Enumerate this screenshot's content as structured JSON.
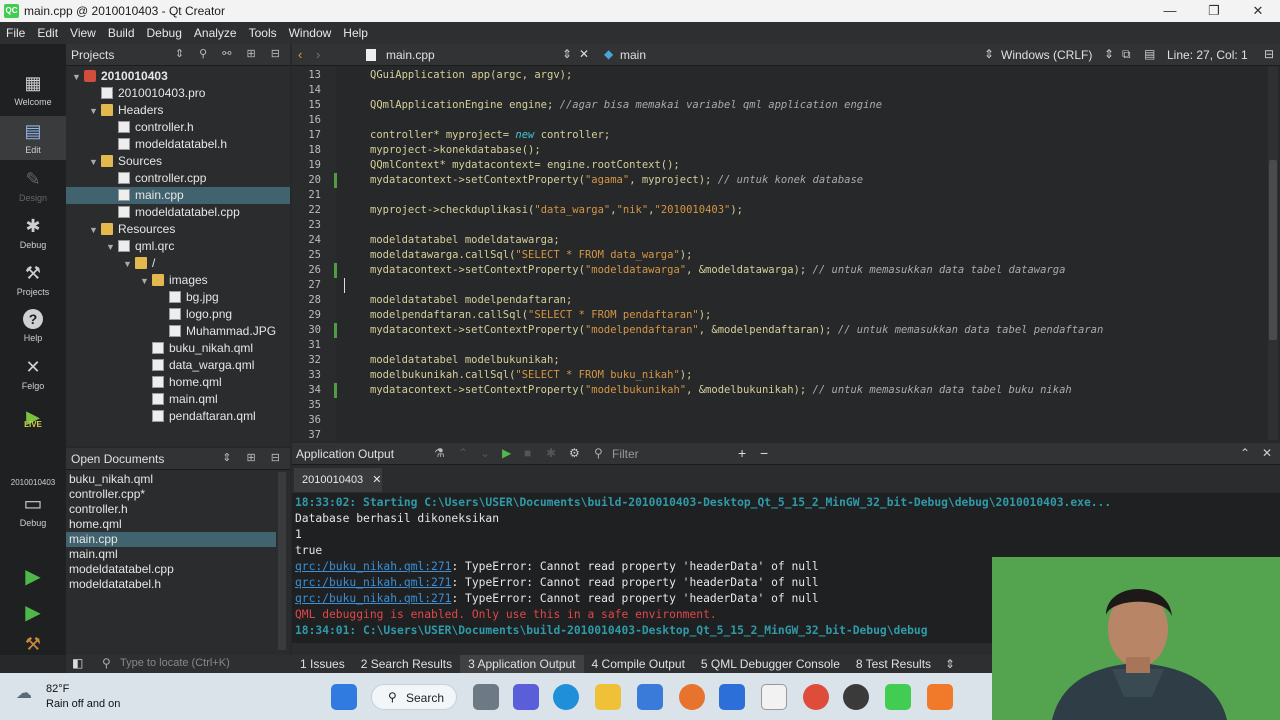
{
  "window": {
    "title": "main.cpp @ 2010010403 - Qt Creator",
    "app_icon_text": "QC",
    "minimize_glyph": "—",
    "maximize_glyph": "❐",
    "close_glyph": "✕"
  },
  "menu": [
    "File",
    "Edit",
    "View",
    "Build",
    "Debug",
    "Analyze",
    "Tools",
    "Window",
    "Help"
  ],
  "modes": [
    {
      "label": "Welcome",
      "icon": "grid-icon",
      "glyph": "▦"
    },
    {
      "label": "Edit",
      "icon": "edit-icon",
      "glyph": "▤"
    },
    {
      "label": "Design",
      "icon": "design-icon",
      "glyph": "✎"
    },
    {
      "label": "Debug",
      "icon": "bug-icon",
      "glyph": "✱"
    },
    {
      "label": "Projects",
      "icon": "wrench-icon",
      "glyph": "⚒"
    },
    {
      "label": "Help",
      "icon": "help-icon",
      "glyph": "?"
    },
    {
      "label": "Felgo",
      "icon": "felgo-icon",
      "glyph": "✕"
    },
    {
      "label": "LIVE",
      "icon": "live-icon",
      "glyph": "▶"
    }
  ],
  "kit": {
    "project": "2010010403",
    "label": "Debug"
  },
  "projects_pane": {
    "title": "Projects",
    "tree": [
      {
        "label": "2010010403",
        "depth": 0,
        "type": "proj",
        "expanded": true,
        "bold": true
      },
      {
        "label": "2010010403.pro",
        "depth": 1,
        "type": "file"
      },
      {
        "label": "Headers",
        "depth": 1,
        "type": "folder",
        "expanded": true
      },
      {
        "label": "controller.h",
        "depth": 2,
        "type": "file"
      },
      {
        "label": "modeldatatabel.h",
        "depth": 2,
        "type": "file"
      },
      {
        "label": "Sources",
        "depth": 1,
        "type": "folder",
        "expanded": true
      },
      {
        "label": "controller.cpp",
        "depth": 2,
        "type": "file"
      },
      {
        "label": "main.cpp",
        "depth": 2,
        "type": "file",
        "selected": true
      },
      {
        "label": "modeldatatabel.cpp",
        "depth": 2,
        "type": "file"
      },
      {
        "label": "Resources",
        "depth": 1,
        "type": "folder",
        "expanded": true
      },
      {
        "label": "qml.qrc",
        "depth": 2,
        "type": "file",
        "expanded": true
      },
      {
        "label": "/",
        "depth": 3,
        "type": "folder",
        "expanded": true
      },
      {
        "label": "images",
        "depth": 4,
        "type": "folder",
        "expanded": true
      },
      {
        "label": "bg.jpg",
        "depth": 5,
        "type": "file"
      },
      {
        "label": "logo.png",
        "depth": 5,
        "type": "file"
      },
      {
        "label": "Muhammad.JPG",
        "depth": 5,
        "type": "file"
      },
      {
        "label": "buku_nikah.qml",
        "depth": 4,
        "type": "file"
      },
      {
        "label": "data_warga.qml",
        "depth": 4,
        "type": "file"
      },
      {
        "label": "home.qml",
        "depth": 4,
        "type": "file"
      },
      {
        "label": "main.qml",
        "depth": 4,
        "type": "file"
      },
      {
        "label": "pendaftaran.qml",
        "depth": 4,
        "type": "file"
      }
    ]
  },
  "open_documents": {
    "title": "Open Documents",
    "items": [
      "buku_nikah.qml",
      "controller.cpp*",
      "controller.h",
      "home.qml",
      "main.cpp",
      "main.qml",
      "modeldatatabel.cpp",
      "modeldatatabel.h"
    ],
    "selected_index": 4
  },
  "editor": {
    "file": "main.cpp",
    "symbol": "main",
    "encoding": "Windows (CRLF)",
    "position": "Line: 27, Col: 1",
    "lines": [
      {
        "n": "13",
        "code": [
          [
            "QGuiApplication app(argc, argv);",
            ""
          ]
        ]
      },
      {
        "n": "14",
        "code": []
      },
      {
        "n": "15",
        "code": [
          [
            "QQmlApplicationEngine engine; ",
            ""
          ],
          [
            "//agar bisa memakai variabel qml application engine",
            "c"
          ]
        ]
      },
      {
        "n": "16",
        "code": []
      },
      {
        "n": "17",
        "code": [
          [
            "controller* myproject= ",
            ""
          ],
          [
            "new",
            "k"
          ],
          [
            " controller;",
            ""
          ]
        ]
      },
      {
        "n": "18",
        "code": [
          [
            "myproject->konekdatabase();",
            ""
          ]
        ]
      },
      {
        "n": "19",
        "code": [
          [
            "QQmlContext* mydatacontext= engine.rootContext();",
            ""
          ]
        ]
      },
      {
        "n": "20",
        "mark": true,
        "code": [
          [
            "mydatacontext->setContextProperty(",
            ""
          ],
          [
            "\"agama\"",
            "s"
          ],
          [
            ", myproject); ",
            ""
          ],
          [
            "// untuk konek database",
            "c"
          ]
        ]
      },
      {
        "n": "21",
        "code": []
      },
      {
        "n": "22",
        "code": [
          [
            "myproject->checkduplikasi(",
            ""
          ],
          [
            "\"data_warga\"",
            "s"
          ],
          [
            ",",
            ""
          ],
          [
            "\"nik\"",
            "s"
          ],
          [
            ",",
            ""
          ],
          [
            "\"2010010403\"",
            "s"
          ],
          [
            ");",
            ""
          ]
        ]
      },
      {
        "n": "23",
        "code": []
      },
      {
        "n": "24",
        "code": [
          [
            "modeldatatabel modeldatawarga;",
            ""
          ]
        ]
      },
      {
        "n": "25",
        "code": [
          [
            "modeldatawarga.callSql(",
            ""
          ],
          [
            "\"SELECT * FROM data_warga\"",
            "s"
          ],
          [
            ");",
            ""
          ]
        ]
      },
      {
        "n": "26",
        "mark": true,
        "code": [
          [
            "mydatacontext->setContextProperty(",
            ""
          ],
          [
            "\"modeldatawarga\"",
            "s"
          ],
          [
            ", &modeldatawarga); ",
            ""
          ],
          [
            "// untuk memasukkan data tabel datawarga",
            "c"
          ]
        ]
      },
      {
        "n": "27",
        "code": []
      },
      {
        "n": "28",
        "code": [
          [
            "modeldatatabel modelpendaftaran;",
            ""
          ]
        ]
      },
      {
        "n": "29",
        "code": [
          [
            "modelpendaftaran.callSql(",
            ""
          ],
          [
            "\"SELECT * FROM pendaftaran\"",
            "s"
          ],
          [
            ");",
            ""
          ]
        ]
      },
      {
        "n": "30",
        "mark": true,
        "code": [
          [
            "mydatacontext->setContextProperty(",
            ""
          ],
          [
            "\"modelpendaftaran\"",
            "s"
          ],
          [
            ", &modelpendaftaran); ",
            ""
          ],
          [
            "// untuk memasukkan data tabel pendaftaran",
            "c"
          ]
        ]
      },
      {
        "n": "31",
        "code": []
      },
      {
        "n": "32",
        "code": [
          [
            "modeldatatabel modelbukunikah;",
            ""
          ]
        ]
      },
      {
        "n": "33",
        "code": [
          [
            "modelbukunikah.callSql(",
            ""
          ],
          [
            "\"SELECT * FROM buku_nikah\"",
            "s"
          ],
          [
            ");",
            ""
          ]
        ]
      },
      {
        "n": "34",
        "mark": true,
        "code": [
          [
            "mydatacontext->setContextProperty(",
            ""
          ],
          [
            "\"modelbukunikah\"",
            "s"
          ],
          [
            ", &modelbukunikah); ",
            ""
          ],
          [
            "// untuk memasukkan data tabel buku nikah",
            "c"
          ]
        ]
      },
      {
        "n": "35",
        "code": []
      },
      {
        "n": "36",
        "code": []
      },
      {
        "n": "37",
        "code": []
      }
    ]
  },
  "output_pane": {
    "title": "Application Output",
    "filter_placeholder": "Filter",
    "tab": "2010010403",
    "lines": [
      {
        "text": "18:33:02: Starting C:\\Users\\USER\\Documents\\build-2010010403-Desktop_Qt_5_15_2_MinGW_32_bit-Debug\\debug\\2010010403.exe...",
        "color": "#2f9aa8",
        "bold": true
      },
      {
        "text": "Database berhasil dikoneksikan",
        "color": "#e6e6e6"
      },
      {
        "text": "1",
        "color": "#e6e6e6"
      },
      {
        "text": "true",
        "color": "#e6e6e6"
      },
      {
        "link": "qrc:/buku_nikah.qml:271",
        "text": ": TypeError: Cannot read property 'headerData' of null",
        "color": "#e6e6e6"
      },
      {
        "link": "qrc:/buku_nikah.qml:271",
        "text": ": TypeError: Cannot read property 'headerData' of null",
        "color": "#e6e6e6"
      },
      {
        "link": "qrc:/buku_nikah.qml:271",
        "text": ": TypeError: Cannot read property 'headerData' of null",
        "color": "#e6e6e6"
      },
      {
        "text": "QML debugging is enabled. Only use this in a safe environment.",
        "color": "#e04848"
      },
      {
        "text": "18:34:01: C:\\Users\\USER\\Documents\\build-2010010403-Desktop_Qt_5_15_2_MinGW_32_bit-Debug\\debug",
        "color": "#2f9aa8",
        "bold": true
      }
    ]
  },
  "bottom_bar": {
    "locate_placeholder": "Type to locate (Ctrl+K)",
    "tabs": [
      {
        "label": "1  Issues"
      },
      {
        "label": "2  Search Results"
      },
      {
        "label": "3  Application Output",
        "active": true
      },
      {
        "label": "4  Compile Output"
      },
      {
        "label": "5  QML Debugger Console"
      },
      {
        "label": "8  Test Results"
      }
    ]
  },
  "taskbar": {
    "weather_temp": "82°F",
    "weather_text": "Rain off and on",
    "search_label": "Search"
  },
  "colors": {
    "accent": "#41cd52",
    "selection": "#41626f",
    "link": "#3a8fd6"
  }
}
